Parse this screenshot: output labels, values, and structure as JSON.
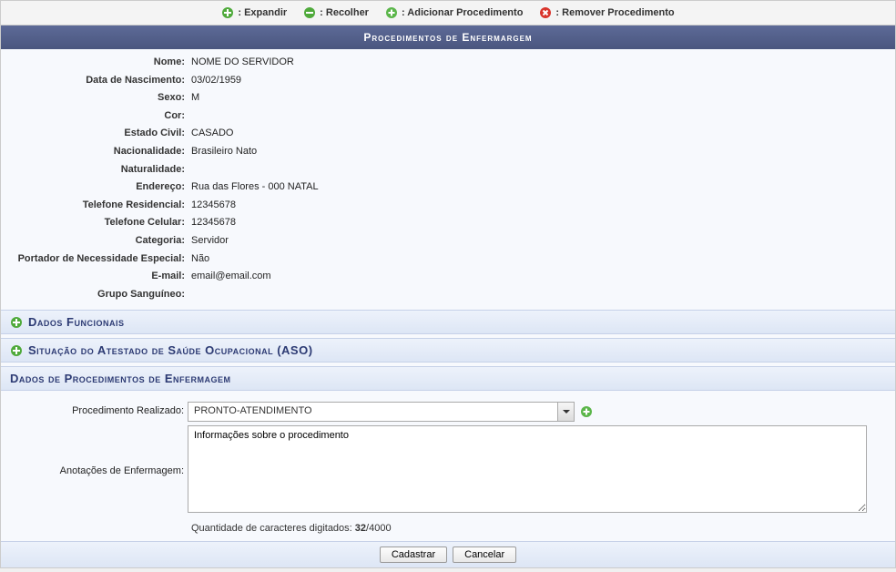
{
  "toolbar": {
    "expand_label": ": Expandir",
    "collapse_label": ": Recolher",
    "add_proc_label": ": Adicionar Procedimento",
    "remove_proc_label": ": Remover Procedimento"
  },
  "banner": {
    "title": "Procedimentos de Enfermargem"
  },
  "patient": {
    "labels": {
      "nome": "Nome:",
      "nasc": "Data de Nascimento:",
      "sexo": "Sexo:",
      "cor": "Cor:",
      "estado_civil": "Estado Civil:",
      "nacionalidade": "Nacionalidade:",
      "naturalidade": "Naturalidade:",
      "endereco": "Endereço:",
      "tel_res": "Telefone Residencial:",
      "tel_cel": "Telefone Celular:",
      "categoria": "Categoria:",
      "portador": "Portador de Necessidade Especial:",
      "email": "E-mail:",
      "grupo_sang": "Grupo Sanguíneo:"
    },
    "values": {
      "nome": "NOME DO SERVIDOR",
      "nasc": "03/02/1959",
      "sexo": "M",
      "cor": "",
      "estado_civil": "CASADO",
      "nacionalidade": "Brasileiro Nato",
      "naturalidade": "",
      "endereco": "Rua das Flores - 000       NATAL",
      "tel_res": "12345678",
      "tel_cel": "12345678",
      "categoria": "Servidor",
      "portador": "Não",
      "email": "email@email.com",
      "grupo_sang": ""
    }
  },
  "sections": {
    "funcionais": "Dados Funcionais",
    "aso": "Situação do Atestado de Saúde Ocupacional (ASO)",
    "dados_proc": "Dados de Procedimentos de Enfermagem"
  },
  "proc_form": {
    "labels": {
      "procedimento": "Procedimento Realizado:",
      "anotacoes": "Anotações de Enfermagem:"
    },
    "procedimento_value": "PRONTO-ATENDIMENTO",
    "anotacoes_value": "Informações sobre o procedimento",
    "char_count_prefix": "Quantidade de caracteres digitados: ",
    "char_count_value": "32",
    "char_count_suffix": "/4000"
  },
  "footer": {
    "cadastrar": "Cadastrar",
    "cancelar": "Cancelar"
  }
}
